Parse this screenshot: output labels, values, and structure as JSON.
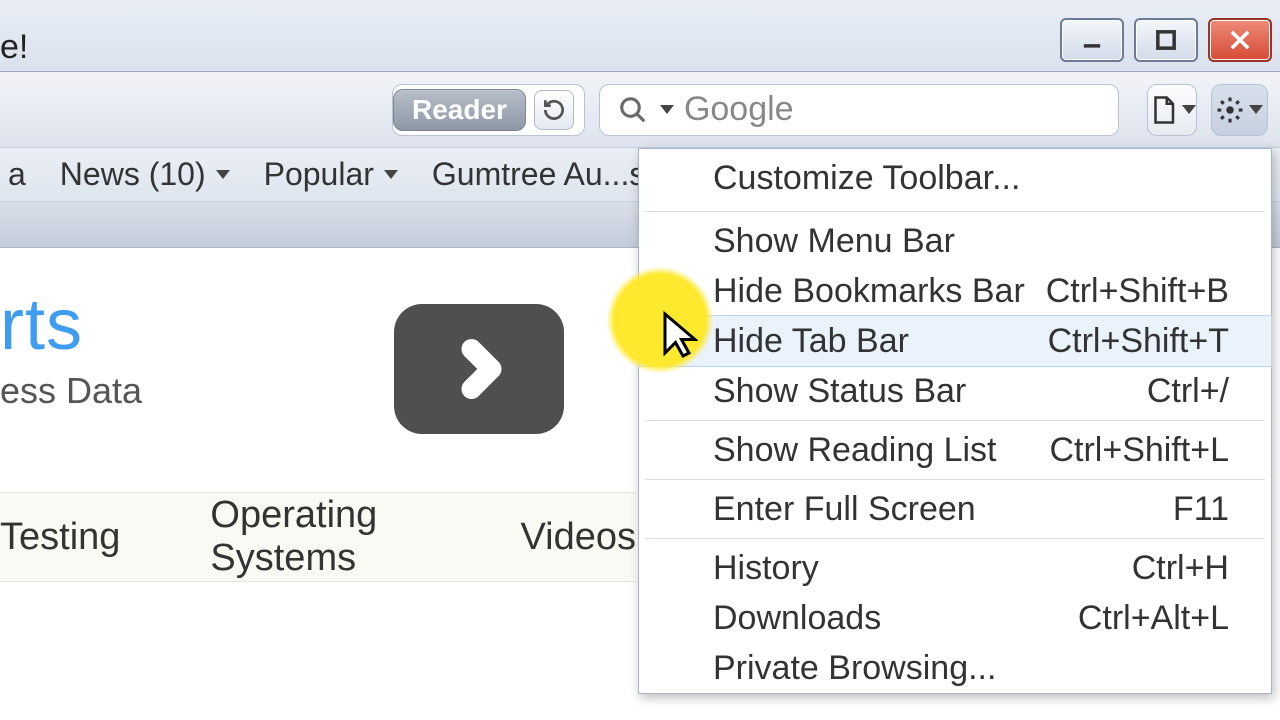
{
  "window": {
    "tab_title": "e!"
  },
  "toolbar": {
    "reader_label": "Reader",
    "search_placeholder": "Google"
  },
  "bookmarks": {
    "items": [
      {
        "label": "a"
      },
      {
        "label": "News (10)"
      },
      {
        "label": "Popular"
      },
      {
        "label": "Gumtree Au...ssifieds."
      }
    ]
  },
  "page": {
    "hero_title": "rts",
    "hero_sub": "ess Data",
    "nav": [
      {
        "label": "Testing"
      },
      {
        "label": "Operating Systems"
      },
      {
        "label": "Videos"
      }
    ]
  },
  "menu": {
    "items": [
      {
        "label": "Customize Toolbar...",
        "shortcut": ""
      },
      {
        "sep": true
      },
      {
        "label": "Show Menu Bar",
        "shortcut": ""
      },
      {
        "label": "Hide Bookmarks Bar",
        "shortcut": "Ctrl+Shift+B"
      },
      {
        "label": "Hide Tab Bar",
        "shortcut": "Ctrl+Shift+T",
        "hover": true
      },
      {
        "label": "Show Status Bar",
        "shortcut": "Ctrl+/"
      },
      {
        "sep": true
      },
      {
        "label": "Show Reading List",
        "shortcut": "Ctrl+Shift+L"
      },
      {
        "sep": true
      },
      {
        "label": "Enter Full Screen",
        "shortcut": "F11"
      },
      {
        "sep": true
      },
      {
        "label": "History",
        "shortcut": "Ctrl+H"
      },
      {
        "label": "Downloads",
        "shortcut": "Ctrl+Alt+L"
      },
      {
        "label": "Private Browsing...",
        "shortcut": ""
      }
    ]
  }
}
